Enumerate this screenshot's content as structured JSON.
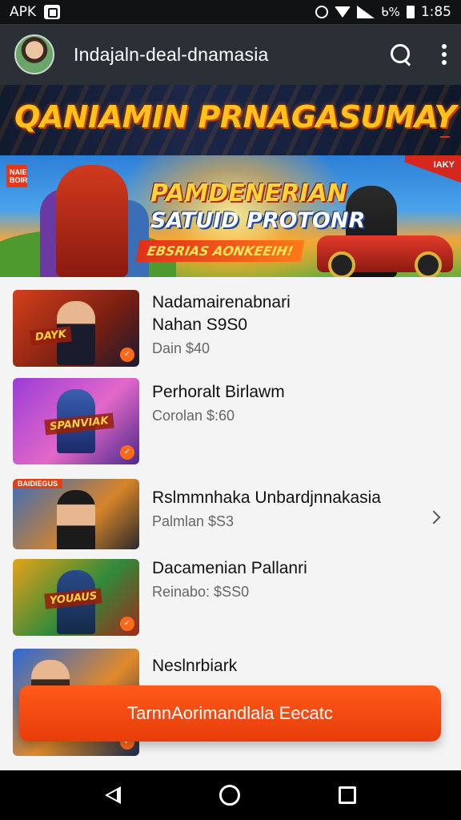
{
  "status_bar": {
    "carrier": "APK",
    "time": "1:85",
    "battery_text": "ᑲ%"
  },
  "app_bar": {
    "title": "Indajaln-deal-dnamasia"
  },
  "promo_banner": {
    "title": "QANIAMIN PRNAGASUMAY"
  },
  "hero_banner": {
    "tag_left": "NAIE BOIR",
    "tag_right": "IAKY",
    "line1": "PAMDENERIAN",
    "line2": "SATUID PROTONR",
    "line3": "EBSRIAS AONKEEIH!"
  },
  "list": {
    "items": [
      {
        "title": "Nadamairenabnari",
        "title2": "Nahan S9S0",
        "subtitle": "Dain $40",
        "thumb_label": "",
        "thumb_logo": "DAYK",
        "colors": [
          "#d4401a",
          "#7a1f12",
          "#1b1b2e"
        ]
      },
      {
        "title": "Perhoralt Birlawm",
        "title2": "",
        "subtitle": "Corolan $:60",
        "thumb_label": "",
        "thumb_logo": "SPANVIAK",
        "colors": [
          "#9b3dd6",
          "#e268c9",
          "#4a2a8a"
        ]
      },
      {
        "title": "Rslmmnhaka Unbardjnnakasia",
        "title2": "",
        "subtitle": "Palmlan $S3",
        "thumb_label": "BAIDIEGUS",
        "thumb_logo": "",
        "colors": [
          "#3a6fb8",
          "#d6842a",
          "#2a2a2a"
        ]
      },
      {
        "title": "Dacamenian Pallanri",
        "title2": "",
        "subtitle": "Reinabo: $SS0",
        "thumb_label": "",
        "thumb_logo": "YOUAUS",
        "colors": [
          "#e6a21a",
          "#2f8a3a",
          "#a02a1a"
        ]
      },
      {
        "title": "Neslnrbiark",
        "title2": "",
        "subtitle": "",
        "thumb_label": "",
        "thumb_logo": "",
        "colors": [
          "#2a6ad6",
          "#e08a2a",
          "#1a2a4a"
        ]
      }
    ]
  },
  "cta": {
    "label": "TarnnAorimandlala Eecatc"
  },
  "nav": {
    "back": "back",
    "home": "home",
    "recents": "recents"
  }
}
